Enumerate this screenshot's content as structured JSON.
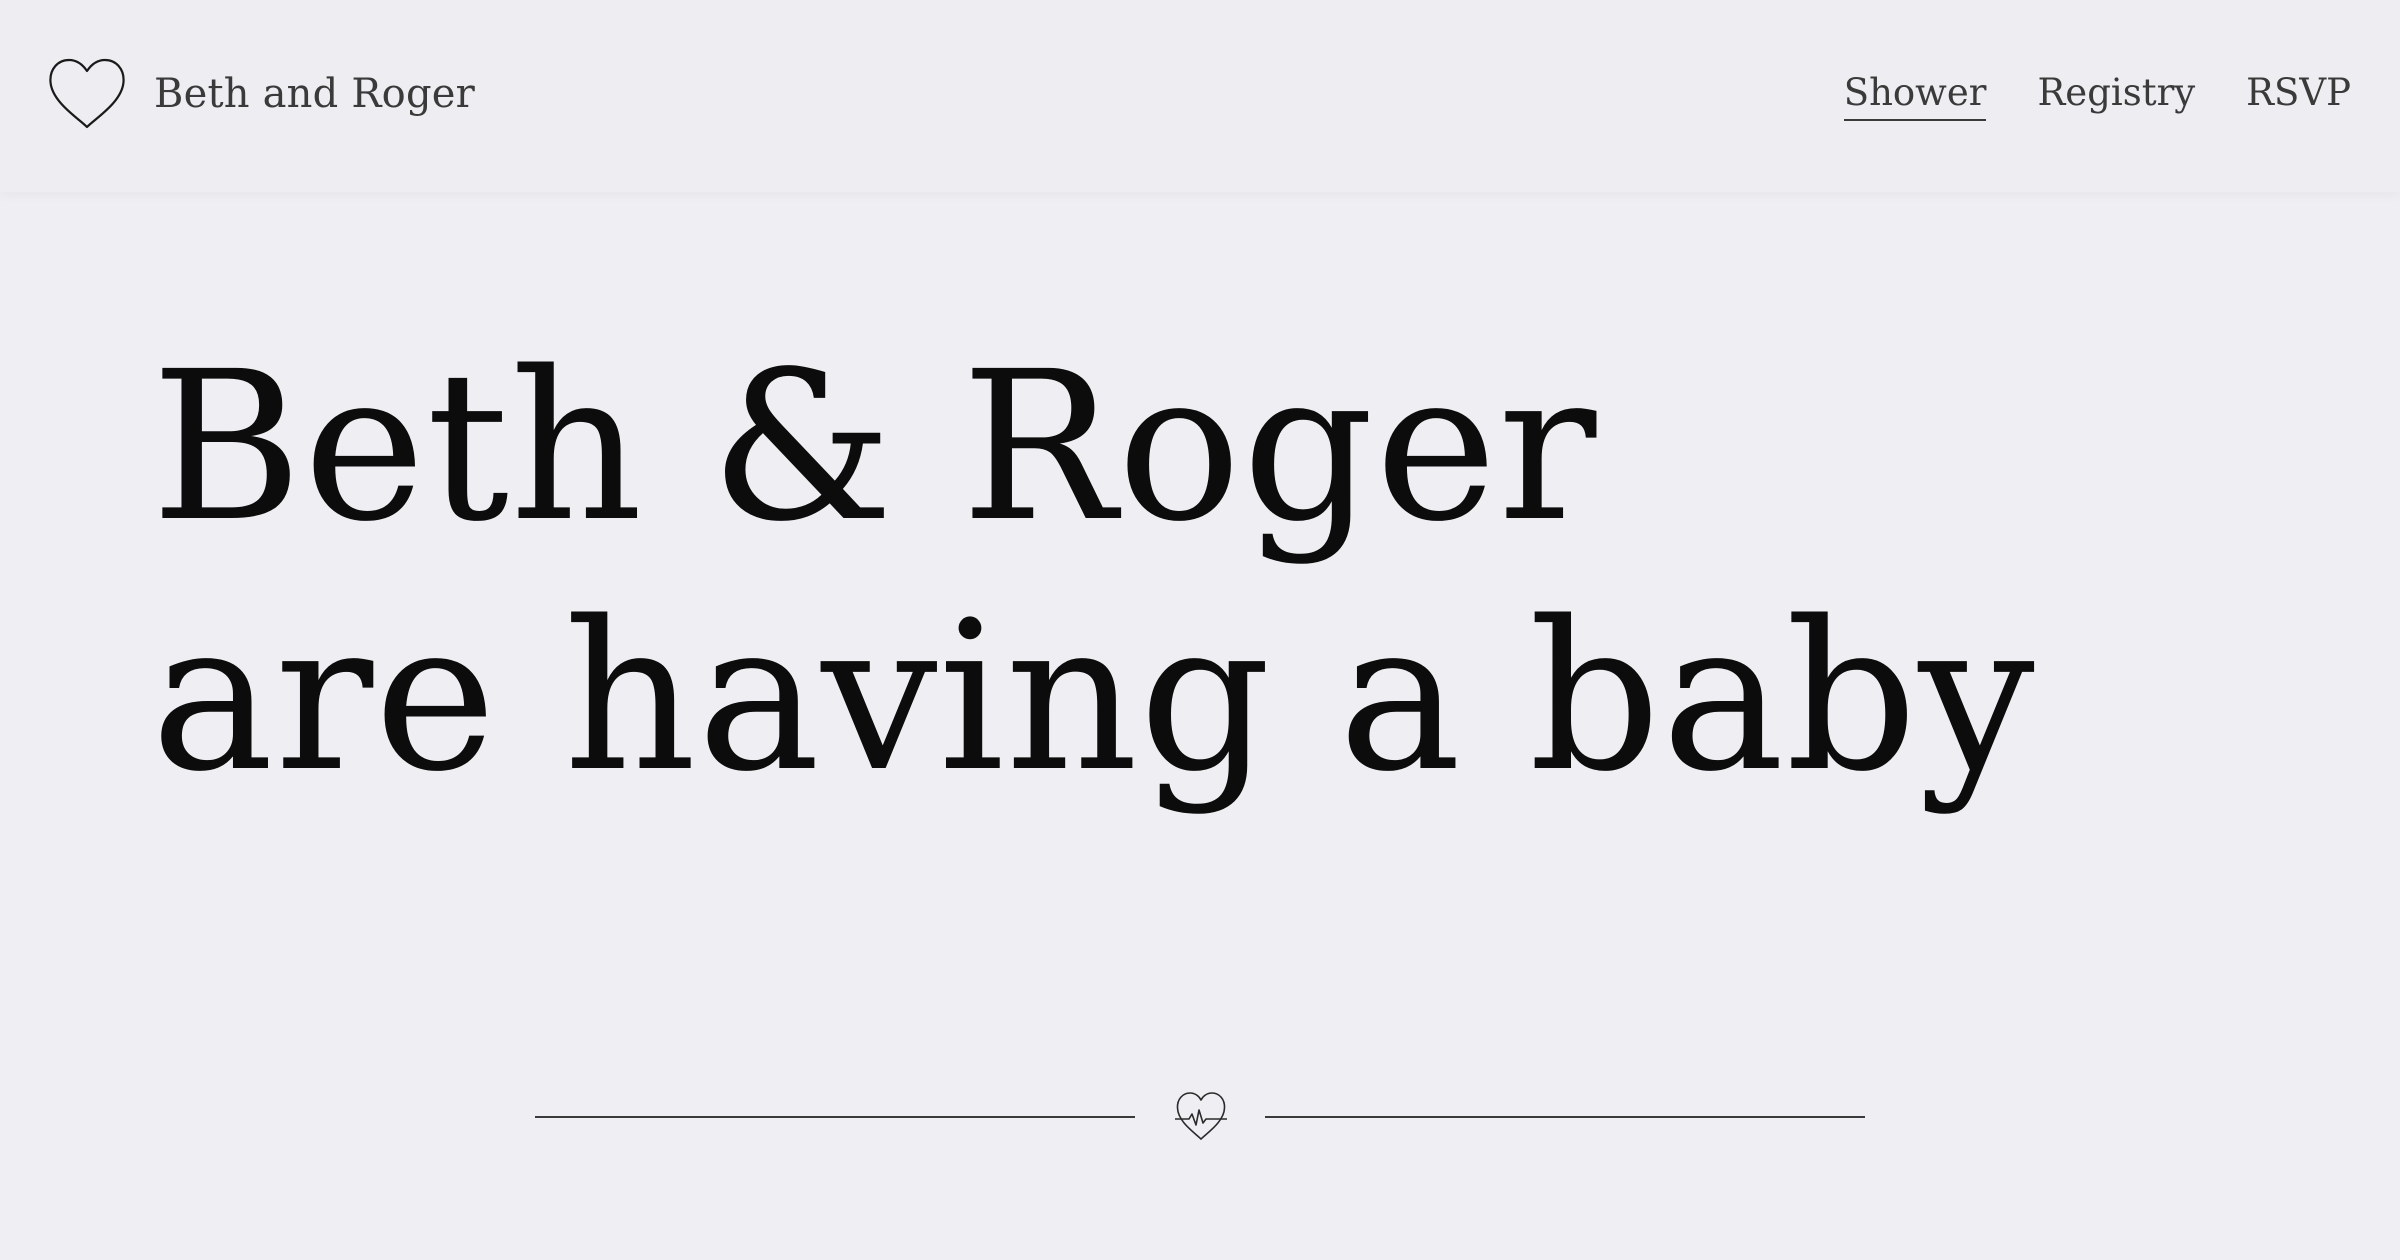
{
  "brand": {
    "name": "Beth and Roger",
    "icon": "heart-outline-icon"
  },
  "nav": {
    "items": [
      {
        "label": "Shower",
        "active": true
      },
      {
        "label": "Registry",
        "active": false
      },
      {
        "label": "RSVP",
        "active": false
      }
    ]
  },
  "hero": {
    "line1": "Beth & Roger",
    "line2": "are having a baby"
  },
  "divider": {
    "icon": "heartbeat-heart-icon"
  },
  "colors": {
    "background": "#efeff3",
    "text": "#3a3a3a",
    "heading": "#0c0c0c"
  }
}
